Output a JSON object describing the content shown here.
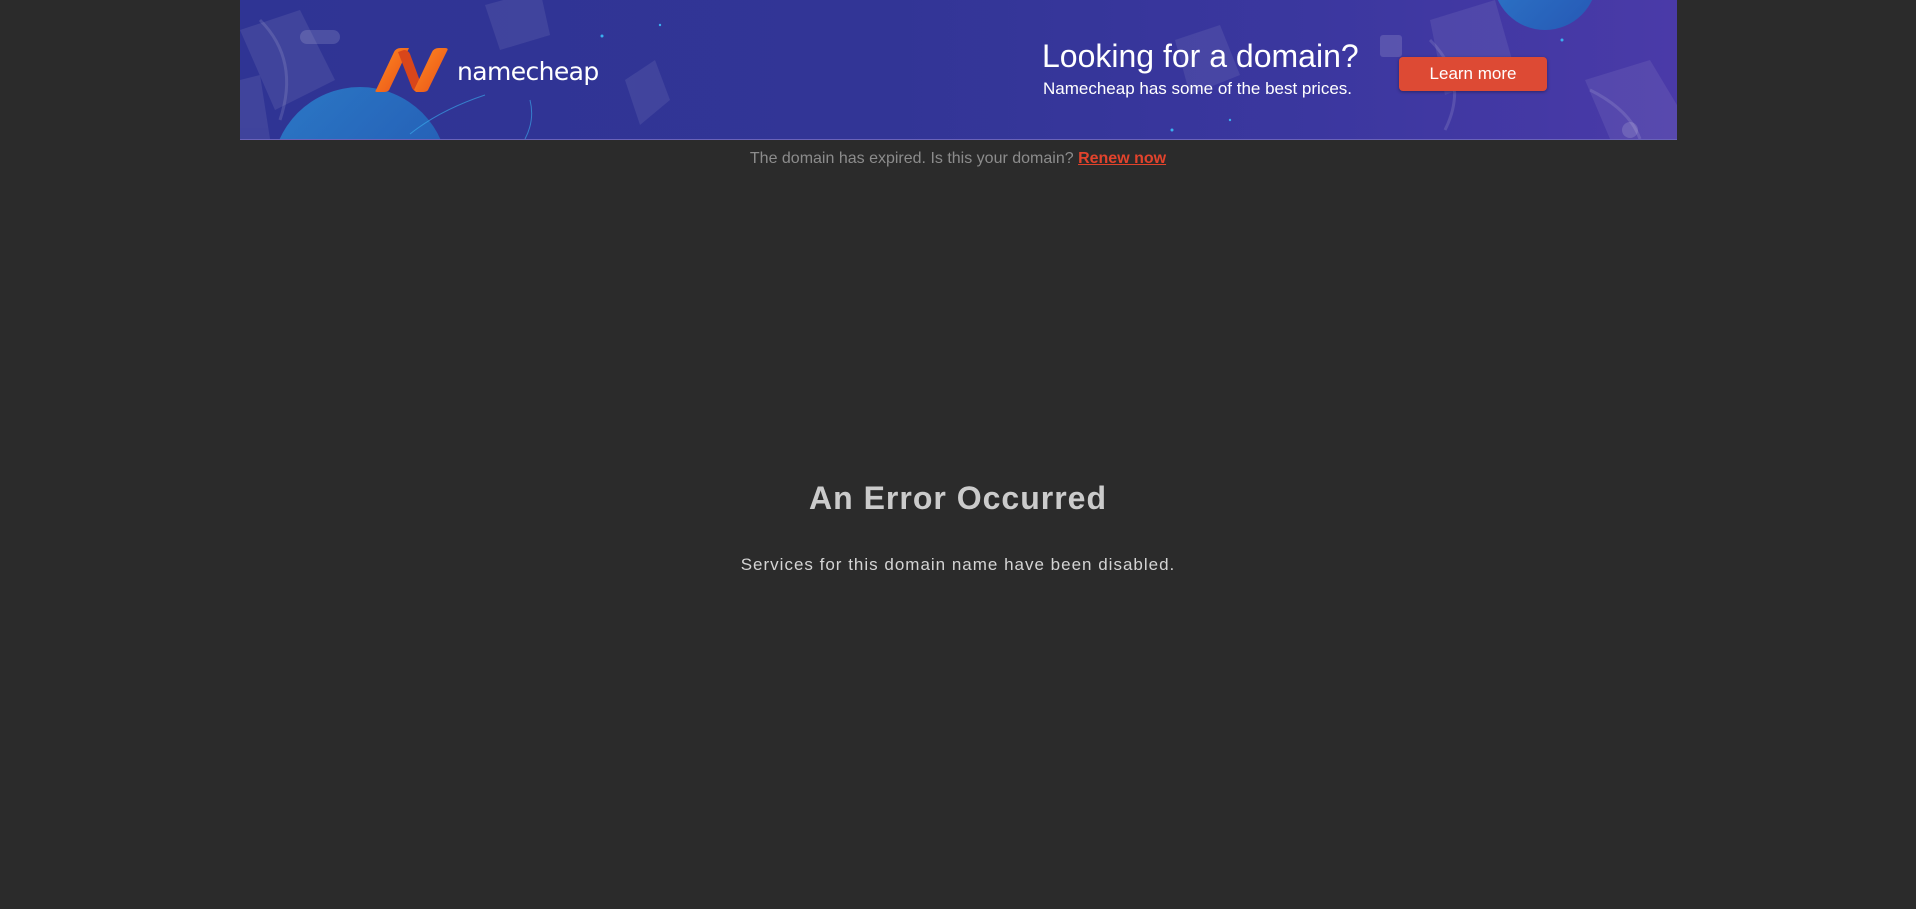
{
  "banner": {
    "logo_text": "namecheap",
    "headline": "Looking for a domain?",
    "subline": "Namecheap has some of the best prices.",
    "cta_label": "Learn more",
    "colors": {
      "background": "#323596",
      "cta": "#dd4a34",
      "logo_orange": "#ff6a1a"
    }
  },
  "notice": {
    "text": "The domain has expired. Is this your domain?",
    "link_label": "Renew now",
    "link_color": "#e2432c"
  },
  "error": {
    "title": "An Error Occurred",
    "message": "Services for this domain name have been disabled."
  },
  "icons": [
    "namecheap-logo-icon"
  ]
}
